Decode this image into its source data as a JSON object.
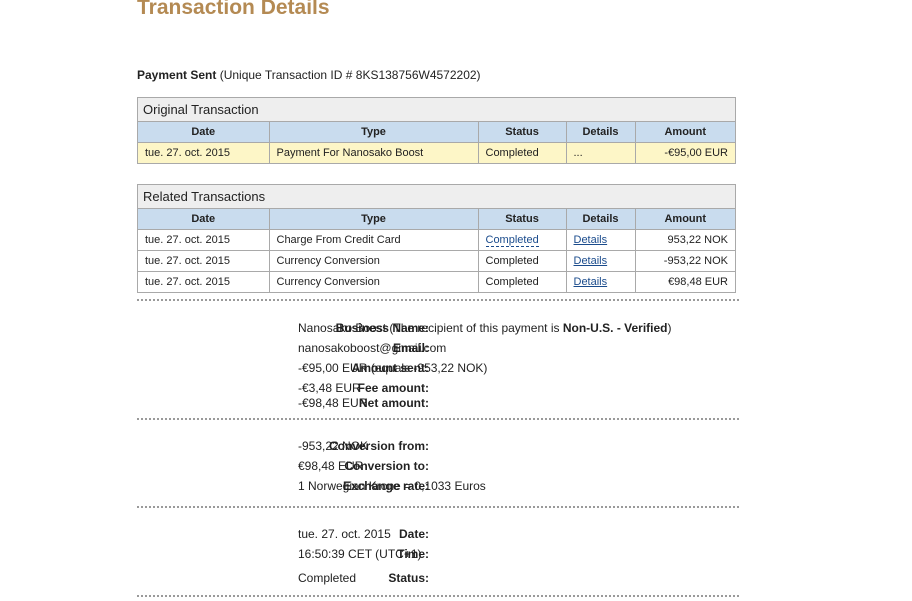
{
  "page_title": "Transaction Details",
  "payment": {
    "label": "Payment Sent",
    "id_text": "(Unique Transaction ID # 8KS138756W4572202)"
  },
  "original": {
    "header": "Original Transaction",
    "columns": [
      "Date",
      "Type",
      "Status",
      "Details",
      "Amount"
    ],
    "row": {
      "date": "tue. 27. oct. 2015",
      "type": "Payment For Nanosako Boost",
      "status": "Completed",
      "details": "...",
      "amount": "-€95,00 EUR"
    }
  },
  "related": {
    "header": "Related Transactions",
    "columns": [
      "Date",
      "Type",
      "Status",
      "Details",
      "Amount"
    ],
    "rows": [
      {
        "date": "tue. 27. oct. 2015",
        "type": "Charge From Credit Card",
        "status": "Completed",
        "details": "Details",
        "amount": "953,22 NOK"
      },
      {
        "date": "tue. 27. oct. 2015",
        "type": "Currency Conversion",
        "status": "Completed",
        "details": "Details",
        "amount": "-953,22 NOK"
      },
      {
        "date": "tue. 27. oct. 2015",
        "type": "Currency Conversion",
        "status": "Completed",
        "details": "Details",
        "amount": "€98,48 EUR"
      }
    ]
  },
  "business": {
    "name_label": "Business Name:",
    "name_value": "Nanosako Boost",
    "recipient_pre": "(The recipient of this payment is ",
    "recipient_status": "Non-U.S. - Verified",
    "recipient_post": ")",
    "email_label": "Email:",
    "email_value": "nanosakoboost@gmail.com",
    "amount_sent_label": "Amount sent:",
    "amount_sent_value": "-€95,00 EUR (equals -953,22 NOK)",
    "fee_label": "Fee amount:",
    "fee_value": "-€3,48 EUR",
    "net_label": "Net amount:",
    "net_value": "-€98,48 EUR"
  },
  "conversion": {
    "from_label": "Conversion from:",
    "from_value": "-953,22 NOK",
    "to_label": "Conversion to:",
    "to_value": "€98,48 EUR",
    "rate_label": "Exchange rate:",
    "rate_value": "1 Norwegian Krone = 0,1033 Euros"
  },
  "meta": {
    "date_label": "Date:",
    "date_value": "tue. 27. oct. 2015",
    "time_label": "Time:",
    "time_value": "16:50:39 CET (UTC+1)",
    "status_label": "Status:",
    "status_value": "Completed"
  }
}
